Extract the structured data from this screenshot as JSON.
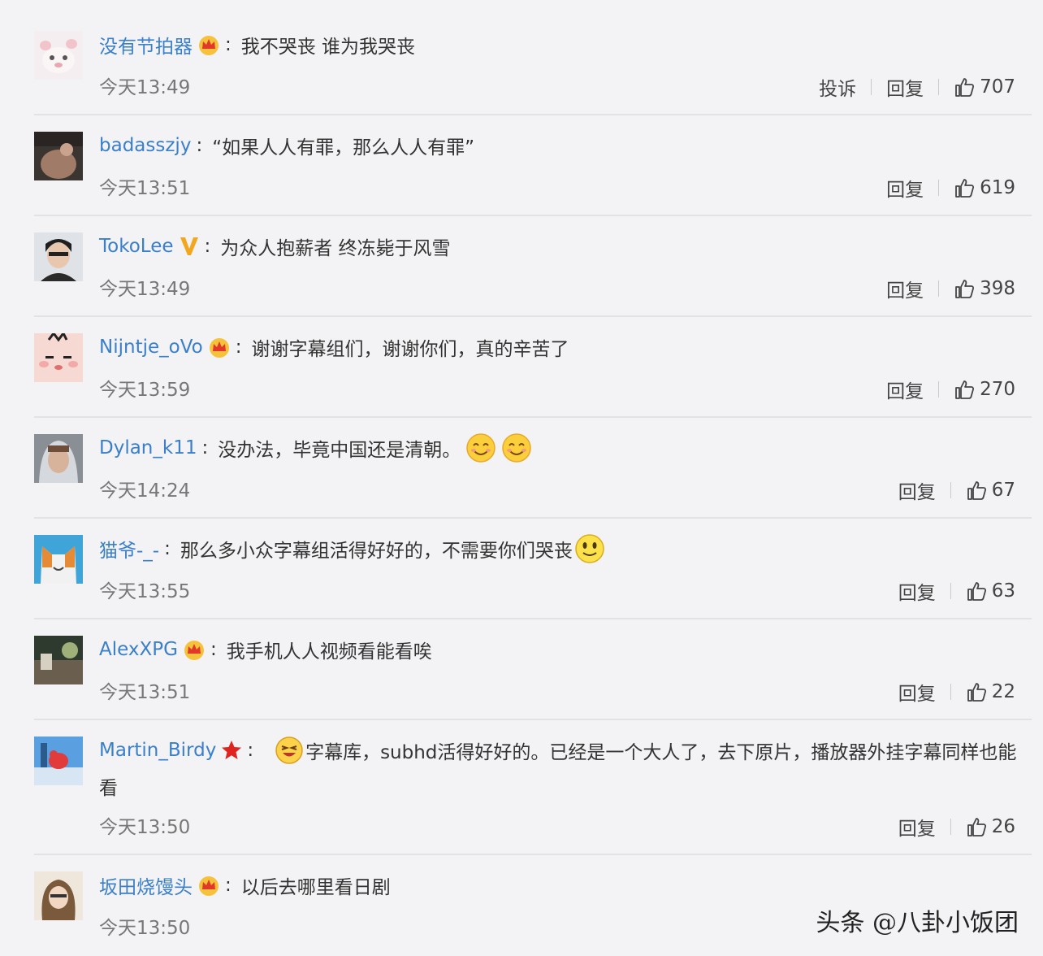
{
  "comments": [
    {
      "username": "没有节拍器",
      "badge": "crown",
      "text": "我不哭丧 谁为我哭丧",
      "time": "今天13:49",
      "report": "投诉",
      "reply": "回复",
      "likes": "707"
    },
    {
      "username": "badasszjy",
      "text": "“如果人人有罪，那么人人有罪”",
      "time": "今天13:51",
      "reply": "回复",
      "likes": "619"
    },
    {
      "username": "TokoLee",
      "badge": "verified-v",
      "text": "为众人抱薪者 终冻毙于风雪",
      "time": "今天13:49",
      "reply": "回复",
      "likes": "398"
    },
    {
      "username": "Nijntje_oVo",
      "badge": "crown",
      "text": "谢谢字幕组们，谢谢你们，真的辛苦了",
      "time": "今天13:59",
      "reply": "回复",
      "likes": "270"
    },
    {
      "username": "Dylan_k11",
      "text": "没办法，毕竟中国还是清朝。",
      "emojis": [
        "smile-emoji",
        "smile-emoji"
      ],
      "time": "今天14:24",
      "reply": "回复",
      "likes": "67"
    },
    {
      "username": "猫爷-_-",
      "text": "那么多小众字幕组活得好好的，不需要你们哭丧",
      "emojis": [
        "smiley-emoji"
      ],
      "time": "今天13:55",
      "reply": "回复",
      "likes": "63"
    },
    {
      "username": "AlexXPG",
      "badge": "crown",
      "text": "我手机人人视频看能看唉",
      "time": "今天13:51",
      "reply": "回复",
      "likes": "22"
    },
    {
      "username": "Martin_Birdy",
      "badge": "star",
      "lead_emoji": "grin-emoji",
      "text": "字幕库，subhd活得好好的。已经是一个大人了，去下原片，播放器外挂字幕同样也能",
      "text_cont": "看",
      "time": "今天13:50",
      "reply": "回复",
      "likes": "26"
    },
    {
      "username": "坂田烧馒头",
      "badge": "crown",
      "text": "以后去哪里看日剧",
      "time": "今天13:50"
    }
  ],
  "watermark": "头条 @八卦小饭团",
  "colors": {
    "username": "#3a7fc9",
    "background": "#f3f3f5",
    "text": "#333333",
    "time": "#777777"
  }
}
